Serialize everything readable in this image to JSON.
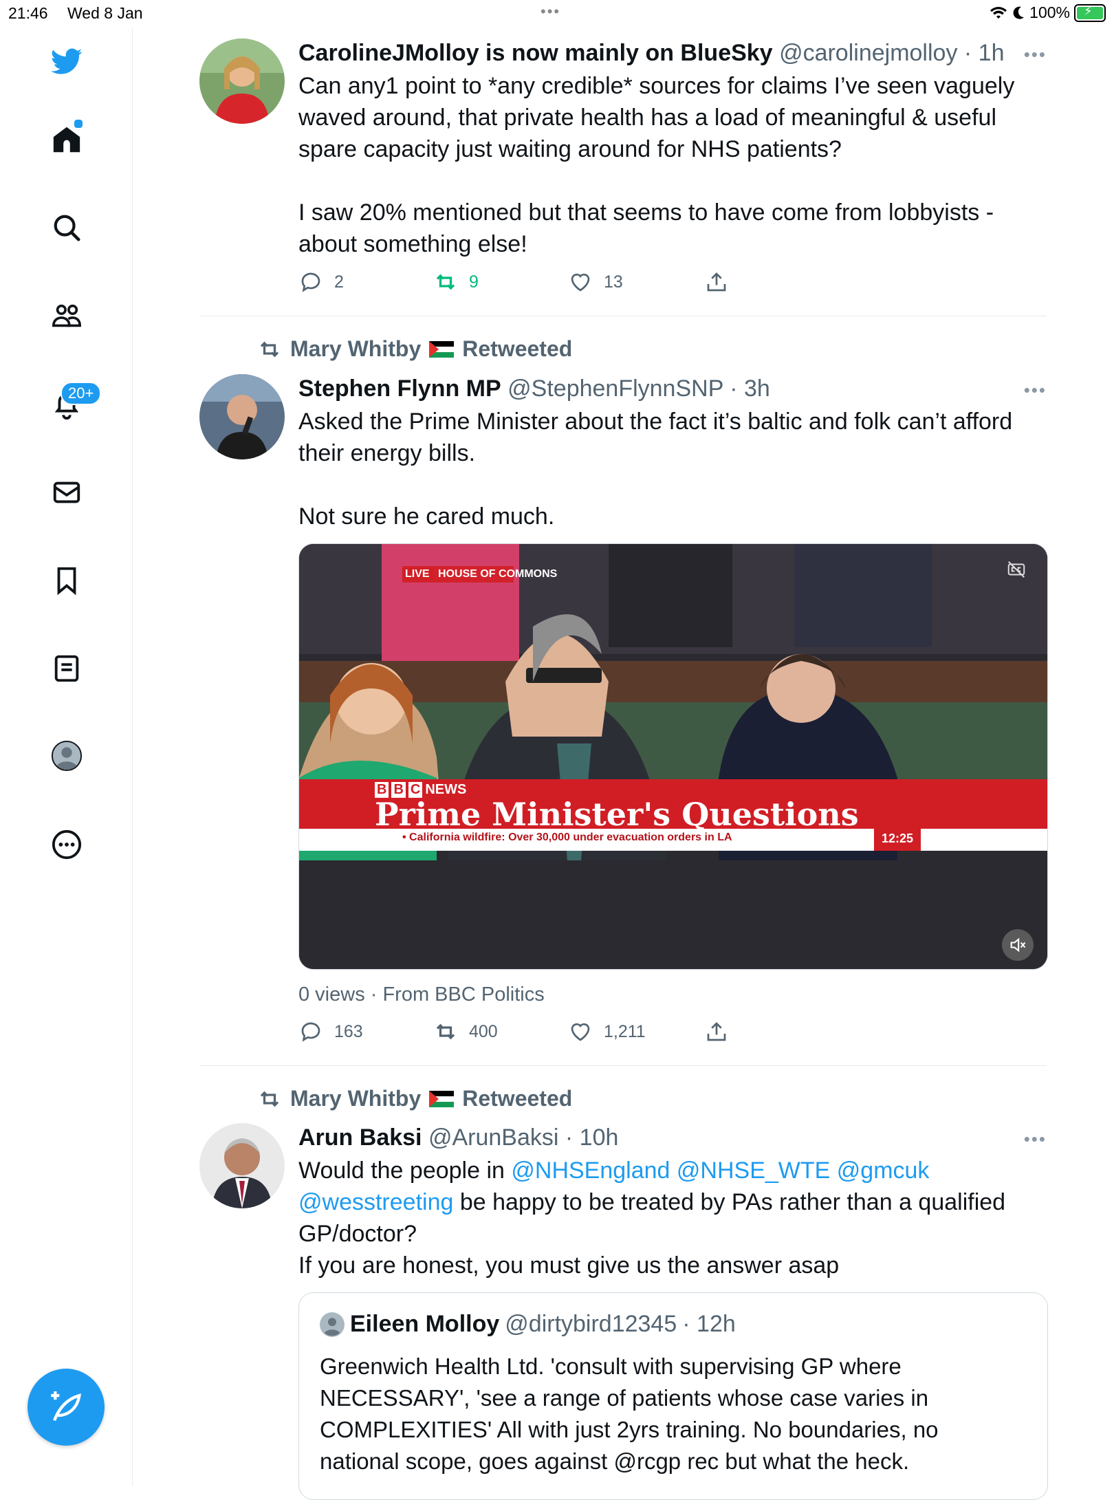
{
  "status_bar": {
    "time": "21:46",
    "date": "Wed 8 Jan",
    "battery": "100%"
  },
  "sidebar": {
    "notification_badge": "20+",
    "items": [
      "twitter-logo",
      "home-icon",
      "search-icon",
      "communities-icon",
      "notifications-icon",
      "messages-icon",
      "bookmarks-icon",
      "lists-icon",
      "profile-icon",
      "more-icon"
    ]
  },
  "colors": {
    "accent": "#1d9bf0",
    "retweet_green": "#00ba7c",
    "secondary_text": "#536471",
    "divider": "#e6ecf0"
  },
  "tweets": [
    {
      "name": "CarolineJMolloy is now mainly on BlueSky",
      "handle": "@carolinejmolloy",
      "time": "· 1h",
      "para1": "Can any1 point to *any credible* sources for claims I’ve seen vaguely waved around, that private health has a load of meaningful & useful spare capacity just waiting around for NHS patients?",
      "para2": "I saw 20% mentioned but that seems to have come from lobbyists - about something else!",
      "replies": "2",
      "retweets": "9",
      "likes": "13"
    },
    {
      "retweeted_by": "Mary Whitby",
      "retweeted_label": "Retweeted",
      "name": "Stephen Flynn MP",
      "handle": "@StephenFlynnSNP",
      "time": "· 3h",
      "para1": "Asked the Prime Minister about the fact it’s baltic and folk can’t afford their energy bills.",
      "para2": "Not sure he cared much.",
      "video": {
        "live_tag": "LIVE",
        "channel": "HOUSE OF COMMONS",
        "news_brand": "NEWS",
        "programme": "Prime Minister's Questions",
        "ticker": "• California wildfire: Over 30,000 under evacuation orders in LA",
        "clock": "12:25"
      },
      "views": "0 views · From BBC Politics",
      "replies": "163",
      "retweets": "400",
      "likes": "1,211"
    },
    {
      "retweeted_by": "Mary Whitby",
      "retweeted_label": "Retweeted",
      "name": "Arun Baksi",
      "handle": "@ArunBaksi",
      "time": "· 10h",
      "mentions_line1": "@NHSEngland @NHSE_WTE @gmcuk",
      "text_prefix": "Would the people in ",
      "mention_line2": "@wesstreeting",
      "text_rest": " be happy to be treated by PAs rather than a qualified GP/doctor?",
      "para2": "If you are honest, you must give us the answer asap",
      "quote": {
        "name": "Eileen Molloy",
        "handle": "@dirtybird12345",
        "time": "· 12h",
        "text": "Greenwich Health Ltd. 'consult with supervising GP where NECESSARY', 'see a range of patients whose case varies in COMPLEXITIES' All with just 2yrs training. No boundaries, no national scope, goes against @rcgp rec but what the heck."
      }
    }
  ]
}
